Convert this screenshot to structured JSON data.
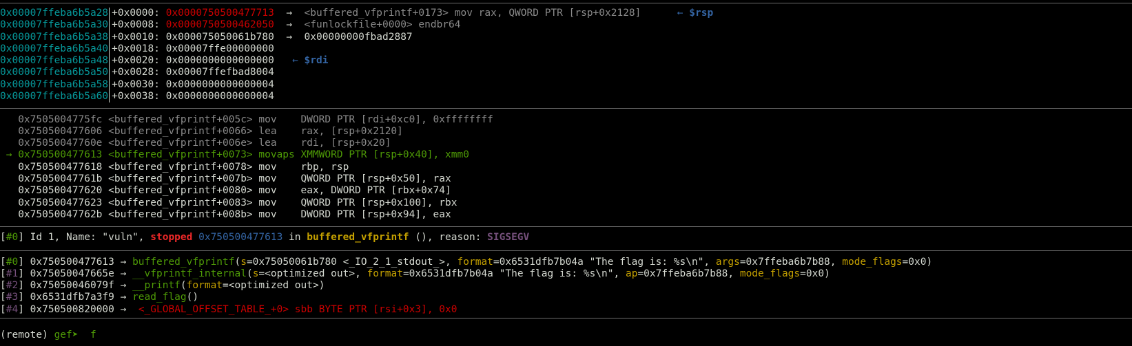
{
  "palette": {
    "cyan": "#06989a",
    "text": "#d3d7cf",
    "dim": "#8a8a8a",
    "red": "#cc0000",
    "green": "#4e9a06",
    "blue": "#3465a4",
    "yellow": "#c4a000",
    "purple": "#75507b",
    "brightred": "#ef2929"
  },
  "stack": {
    "rows": [
      {
        "address": "0x00007ffeba6b5a28",
        "segments": [
          {
            "t": "+0x0000: ",
            "c": "text"
          },
          {
            "t": "0x0000750500477713",
            "c": "red"
          },
          {
            "t": "  →  ",
            "c": "text"
          },
          {
            "t": "<buffered_vfprintf+0173> mov rax, QWORD PTR [rsp+0x2128]",
            "c": "dim"
          },
          {
            "t": "      ",
            "c": "text"
          },
          {
            "t": "← ",
            "c": "blue"
          },
          {
            "t": "$rsp",
            "c": "blue",
            "b": true
          }
        ]
      },
      {
        "address": "0x00007ffeba6b5a30",
        "segments": [
          {
            "t": "+0x0008: ",
            "c": "text"
          },
          {
            "t": "0x0000750500462050",
            "c": "red"
          },
          {
            "t": "  →  ",
            "c": "text"
          },
          {
            "t": "<funlockfile+0000> endbr64",
            "c": "dim"
          }
        ]
      },
      {
        "address": "0x00007ffeba6b5a38",
        "segments": [
          {
            "t": "+0x0010: ",
            "c": "text"
          },
          {
            "t": "0x000075050061b780",
            "c": "text"
          },
          {
            "t": "  →  ",
            "c": "text"
          },
          {
            "t": "0x00000000fbad2887",
            "c": "text"
          }
        ]
      },
      {
        "address": "0x00007ffeba6b5a40",
        "segments": [
          {
            "t": "+0x0018: ",
            "c": "text"
          },
          {
            "t": "0x00007ffe00000000",
            "c": "text"
          }
        ]
      },
      {
        "address": "0x00007ffeba6b5a48",
        "segments": [
          {
            "t": "+0x0020: ",
            "c": "text"
          },
          {
            "t": "0x0000000000000000",
            "c": "text"
          },
          {
            "t": "   ",
            "c": "text"
          },
          {
            "t": "← ",
            "c": "blue"
          },
          {
            "t": "$rdi",
            "c": "blue",
            "b": true
          }
        ]
      },
      {
        "address": "0x00007ffeba6b5a50",
        "segments": [
          {
            "t": "+0x0028: ",
            "c": "text"
          },
          {
            "t": "0x00007ffefbad8004",
            "c": "text"
          }
        ]
      },
      {
        "address": "0x00007ffeba6b5a58",
        "segments": [
          {
            "t": "+0x0030: ",
            "c": "text"
          },
          {
            "t": "0x0000000000000004",
            "c": "text"
          }
        ]
      },
      {
        "address": "0x00007ffeba6b5a60",
        "segments": [
          {
            "t": "+0x0038: ",
            "c": "text"
          },
          {
            "t": "0x0000000000000004",
            "c": "text"
          }
        ]
      }
    ]
  },
  "code": {
    "lines": [
      {
        "segments": [
          {
            "t": "   0x7505004775fc <buffered_vfprintf+005c> mov    DWORD PTR [rdi+0xc0], 0xffffffff",
            "c": "dim"
          }
        ]
      },
      {
        "segments": [
          {
            "t": "   0x750500477606 <buffered_vfprintf+0066> lea    rax, [rsp+0x2120]",
            "c": "dim"
          }
        ]
      },
      {
        "segments": [
          {
            "t": "   0x75050047760e <buffered_vfprintf+006e> lea    rdi, [rsp+0x20]",
            "c": "dim"
          }
        ]
      },
      {
        "segments": [
          {
            "t": " → 0x750500477613 <buffered_vfprintf+0073> movaps XMMWORD PTR [rsp+0x40], xmm0",
            "c": "green"
          }
        ]
      },
      {
        "segments": [
          {
            "t": "   0x750500477618 <buffered_vfprintf+0078> mov    rbp, rsp",
            "c": "text"
          }
        ]
      },
      {
        "segments": [
          {
            "t": "   0x75050047761b <buffered_vfprintf+007b> mov    QWORD PTR [rsp+0x50], rax",
            "c": "text"
          }
        ]
      },
      {
        "segments": [
          {
            "t": "   0x750500477620 <buffered_vfprintf+0080> mov    eax, DWORD PTR [rbx+0x74]",
            "c": "text"
          }
        ]
      },
      {
        "segments": [
          {
            "t": "   0x750500477623 <buffered_vfprintf+0083> mov    QWORD PTR [rsp+0x100], rbx",
            "c": "text"
          }
        ]
      },
      {
        "segments": [
          {
            "t": "   0x75050047762b <buffered_vfprintf+008b> mov    DWORD PTR [rsp+0x94], eax",
            "c": "text"
          }
        ]
      }
    ]
  },
  "threads": {
    "lines": [
      {
        "segments": [
          {
            "t": "[",
            "c": "text"
          },
          {
            "t": "#0",
            "c": "green"
          },
          {
            "t": "] Id 1, Name: \"vuln\", ",
            "c": "text"
          },
          {
            "t": "stopped",
            "c": "brightred",
            "b": true
          },
          {
            "t": " ",
            "c": "text"
          },
          {
            "t": "0x750500477613",
            "c": "blue"
          },
          {
            "t": " in ",
            "c": "text"
          },
          {
            "t": "buffered_vfprintf",
            "c": "yellow",
            "b": true
          },
          {
            "t": " (), reason: ",
            "c": "text"
          },
          {
            "t": "SIGSEGV",
            "c": "purple",
            "b": true
          }
        ]
      }
    ]
  },
  "trace": {
    "lines": [
      {
        "segments": [
          {
            "t": "[",
            "c": "text"
          },
          {
            "t": "#0",
            "c": "green"
          },
          {
            "t": "] 0x750500477613 → ",
            "c": "text"
          },
          {
            "t": "buffered_vfprintf",
            "c": "green"
          },
          {
            "t": "(",
            "c": "text"
          },
          {
            "t": "s",
            "c": "yellow"
          },
          {
            "t": "=0x75050061b780 <_IO_2_1_stdout_>, ",
            "c": "text"
          },
          {
            "t": "format",
            "c": "yellow"
          },
          {
            "t": "=0x6531dfb7b04a \"The flag is: %s\\n\", ",
            "c": "text"
          },
          {
            "t": "args",
            "c": "yellow"
          },
          {
            "t": "=0x7ffeba6b7b88, ",
            "c": "text"
          },
          {
            "t": "mode_flags",
            "c": "yellow"
          },
          {
            "t": "=0x0)",
            "c": "text"
          }
        ]
      },
      {
        "segments": [
          {
            "t": "[",
            "c": "text"
          },
          {
            "t": "#1",
            "c": "purple"
          },
          {
            "t": "] 0x75050047665e → ",
            "c": "text"
          },
          {
            "t": "__vfprintf_internal",
            "c": "green"
          },
          {
            "t": "(",
            "c": "text"
          },
          {
            "t": "s",
            "c": "yellow"
          },
          {
            "t": "=<optimized out>, ",
            "c": "text"
          },
          {
            "t": "format",
            "c": "yellow"
          },
          {
            "t": "=0x6531dfb7b04a \"The flag is: %s\\n\", ",
            "c": "text"
          },
          {
            "t": "ap",
            "c": "yellow"
          },
          {
            "t": "=0x7ffeba6b7b88, ",
            "c": "text"
          },
          {
            "t": "mode_flags",
            "c": "yellow"
          },
          {
            "t": "=0x0)",
            "c": "text"
          }
        ]
      },
      {
        "segments": [
          {
            "t": "[",
            "c": "text"
          },
          {
            "t": "#2",
            "c": "purple"
          },
          {
            "t": "] 0x75050046079f → ",
            "c": "text"
          },
          {
            "t": "__printf",
            "c": "green"
          },
          {
            "t": "(",
            "c": "text"
          },
          {
            "t": "format",
            "c": "yellow"
          },
          {
            "t": "=<optimized out>)",
            "c": "text"
          }
        ]
      },
      {
        "segments": [
          {
            "t": "[",
            "c": "text"
          },
          {
            "t": "#3",
            "c": "purple"
          },
          {
            "t": "] 0x6531dfb7a3f9 → ",
            "c": "text"
          },
          {
            "t": "read_flag",
            "c": "green"
          },
          {
            "t": "()",
            "c": "text"
          }
        ]
      },
      {
        "segments": [
          {
            "t": "[",
            "c": "text"
          },
          {
            "t": "#4",
            "c": "purple"
          },
          {
            "t": "] 0x750500820000 →  ",
            "c": "text"
          },
          {
            "t": "<_GLOBAL_OFFSET_TABLE_+0> sbb BYTE PTR [rsi+0x3], 0x0",
            "c": "red"
          }
        ]
      }
    ]
  },
  "prompt": {
    "segments": [
      {
        "t": "(remote) ",
        "c": "text"
      },
      {
        "t": "gef➤ ",
        "c": "green"
      },
      {
        "t": " f",
        "c": "green"
      }
    ]
  }
}
